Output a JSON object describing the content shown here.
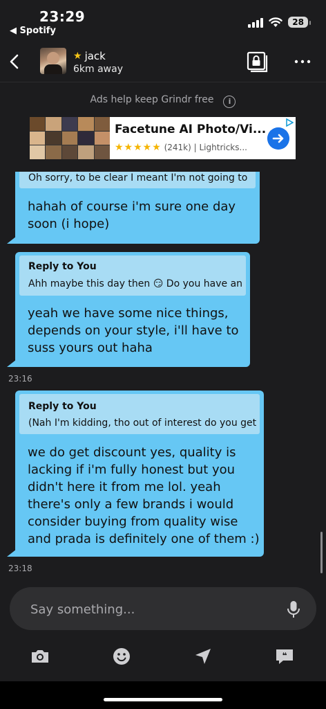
{
  "status_bar": {
    "time": "23:29",
    "back_app": "◀ Spotify",
    "battery": "28"
  },
  "header": {
    "name": "jack",
    "distance": "6km away",
    "icons": [
      "back-chevron-icon",
      "star-icon",
      "album-lock-icon",
      "more-dots-icon"
    ]
  },
  "ad": {
    "note": "Ads help keep Grindr free",
    "title": "Facetune AI Photo/Vi...",
    "rating_count": "(241k)",
    "publisher": "| Lightricks...",
    "stars": "★★★★★"
  },
  "messages": [
    {
      "reply_text": "Oh sorry, to be clear I meant I'm not going to s...",
      "text_lines": [
        "hahah of course i'm sure one day",
        "soon (i hope)"
      ]
    },
    {
      "reply_header": "Reply to You",
      "reply_text_a": "Ahh maybe this day then",
      "reply_emoji": "😏",
      "reply_text_b": "Do you have an...",
      "text_lines": [
        "yeah we have some nice things,",
        "depends on your style, i'll have to",
        "suss yours out haha"
      ],
      "time": "23:16"
    },
    {
      "reply_header": "Reply to You",
      "reply_text": "(Nah I'm kidding, tho out of interest do you get...",
      "text_lines": [
        "we do get discount yes, quality is",
        "lacking if i'm fully honest but you",
        "didn't here it from me lol. yeah",
        "there's only a few brands i would",
        "consider buying from quality wise",
        "and prada is definitely one of them :)"
      ],
      "time": "23:18"
    }
  ],
  "composer": {
    "placeholder": "Say something..."
  },
  "toolbar": [
    "camera-icon",
    "emoji-icon",
    "location-icon",
    "saved-phrases-icon"
  ],
  "colors": {
    "background": "#1c1c1e",
    "bubble": "#66c7f4",
    "reply_box": "#a8dcf4"
  }
}
